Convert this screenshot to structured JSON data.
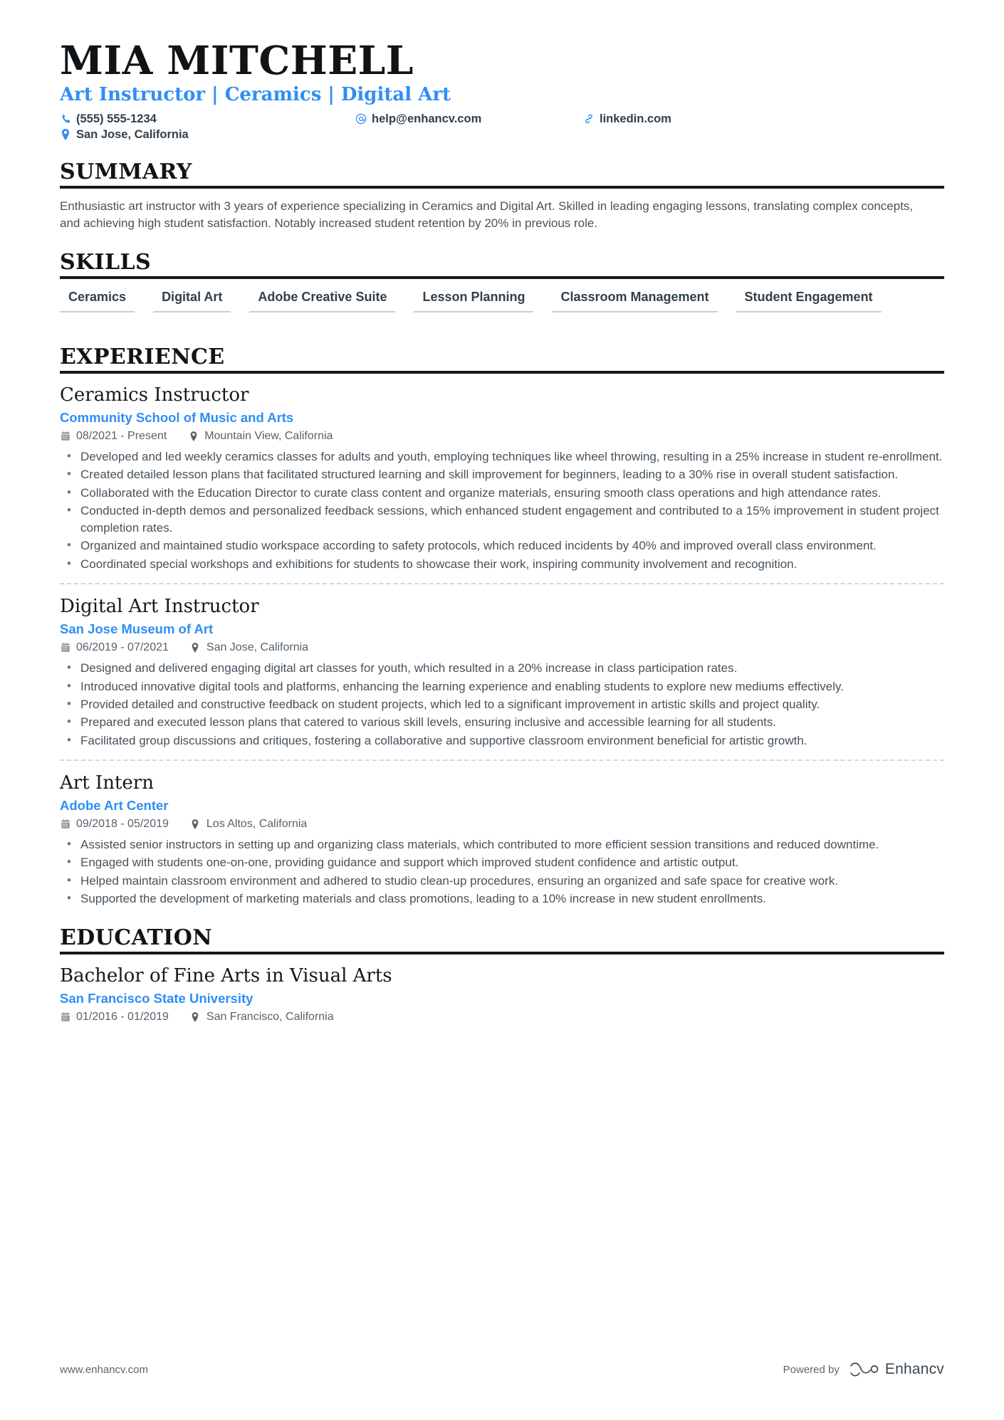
{
  "header": {
    "name": "MIA MITCHELL",
    "headline": "Art Instructor | Ceramics | Digital Art",
    "contacts": [
      {
        "icon": "phone-icon",
        "text": "(555) 555-1234"
      },
      {
        "icon": "email-icon",
        "text": "help@enhancv.com"
      },
      {
        "icon": "link-icon",
        "text": "linkedin.com"
      },
      {
        "icon": "location-icon",
        "text": "San Jose, California"
      }
    ]
  },
  "sections": {
    "summary": {
      "heading": "SUMMARY",
      "text": "Enthusiastic art instructor with 3 years of experience specializing in Ceramics and Digital Art. Skilled in leading engaging lessons, translating complex concepts, and achieving high student satisfaction. Notably increased student retention by 20% in previous role."
    },
    "skills": {
      "heading": "SKILLS",
      "items": [
        "Ceramics",
        "Digital Art",
        "Adobe Creative Suite",
        "Lesson Planning",
        "Classroom Management",
        "Student Engagement"
      ]
    },
    "experience": {
      "heading": "EXPERIENCE",
      "entries": [
        {
          "title": "Ceramics Instructor",
          "organization": "Community School of Music and Arts",
          "dates": "08/2021 - Present",
          "location": "Mountain View, California",
          "bullets": [
            "Developed and led weekly ceramics classes for adults and youth, employing techniques like wheel throwing, resulting in a 25% increase in student re-enrollment.",
            "Created detailed lesson plans that facilitated structured learning and skill improvement for beginners, leading to a 30% rise in overall student satisfaction.",
            "Collaborated with the Education Director to curate class content and organize materials, ensuring smooth class operations and high attendance rates.",
            "Conducted in-depth demos and personalized feedback sessions, which enhanced student engagement and contributed to a 15% improvement in student project completion rates.",
            "Organized and maintained studio workspace according to safety protocols, which reduced incidents by 40% and improved overall class environment.",
            "Coordinated special workshops and exhibitions for students to showcase their work, inspiring community involvement and recognition."
          ]
        },
        {
          "title": "Digital Art Instructor",
          "organization": "San Jose Museum of Art",
          "dates": "06/2019 - 07/2021",
          "location": "San Jose, California",
          "bullets": [
            "Designed and delivered engaging digital art classes for youth, which resulted in a 20% increase in class participation rates.",
            "Introduced innovative digital tools and platforms, enhancing the learning experience and enabling students to explore new mediums effectively.",
            "Provided detailed and constructive feedback on student projects, which led to a significant improvement in artistic skills and project quality.",
            "Prepared and executed lesson plans that catered to various skill levels, ensuring inclusive and accessible learning for all students.",
            "Facilitated group discussions and critiques, fostering a collaborative and supportive classroom environment beneficial for artistic growth."
          ]
        },
        {
          "title": "Art Intern",
          "organization": "Adobe Art Center",
          "dates": "09/2018 - 05/2019",
          "location": "Los Altos, California",
          "bullets": [
            "Assisted senior instructors in setting up and organizing class materials, which contributed to more efficient session transitions and reduced downtime.",
            "Engaged with students one-on-one, providing guidance and support which improved student confidence and artistic output.",
            "Helped maintain classroom environment and adhered to studio clean-up procedures, ensuring an organized and safe space for creative work.",
            "Supported the development of marketing materials and class promotions, leading to a 10% increase in new student enrollments."
          ]
        }
      ]
    },
    "education": {
      "heading": "EDUCATION",
      "entries": [
        {
          "degree": "Bachelor of Fine Arts in Visual Arts",
          "school": "San Francisco State University",
          "dates": "01/2016 - 01/2019",
          "location": "San Francisco, California"
        }
      ]
    }
  },
  "footer": {
    "website": "www.enhancv.com",
    "powered_by": "Powered by",
    "brand": "Enhancv"
  },
  "colors": {
    "accent": "#2f8ef4",
    "text": "#46525c",
    "heading": "#111417",
    "rule": "#16191c"
  }
}
